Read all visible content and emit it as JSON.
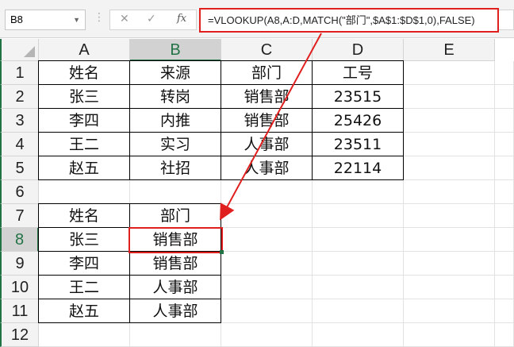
{
  "name_box": "B8",
  "formula_icons": {
    "cancel": "✕",
    "enter": "✓",
    "fx": "fx"
  },
  "formula": "=VLOOKUP(A8,A:D,MATCH(\"部门\",$A$1:$D$1,0),FALSE)",
  "columns": [
    "A",
    "B",
    "C",
    "D",
    "E"
  ],
  "rows": [
    "1",
    "2",
    "3",
    "4",
    "5",
    "6",
    "7",
    "8",
    "9",
    "10",
    "11",
    "12"
  ],
  "selected_cell": "B8",
  "grid": [
    [
      "姓名",
      "来源",
      "部门",
      "工号",
      ""
    ],
    [
      "张三",
      "转岗",
      "销售部",
      "23515",
      ""
    ],
    [
      "李四",
      "内推",
      "销售部",
      "25426",
      ""
    ],
    [
      "王二",
      "实习",
      "人事部",
      "23511",
      ""
    ],
    [
      "赵五",
      "社招",
      "人事部",
      "22114",
      ""
    ],
    [
      "",
      "",
      "",
      "",
      ""
    ],
    [
      "姓名",
      "部门",
      "",
      "",
      ""
    ],
    [
      "张三",
      "销售部",
      "",
      "",
      ""
    ],
    [
      "李四",
      "销售部",
      "",
      "",
      ""
    ],
    [
      "王二",
      "人事部",
      "",
      "",
      ""
    ],
    [
      "赵五",
      "人事部",
      "",
      "",
      ""
    ],
    [
      "",
      "",
      "",
      "",
      ""
    ]
  ],
  "annotation_color": "#e0201f"
}
